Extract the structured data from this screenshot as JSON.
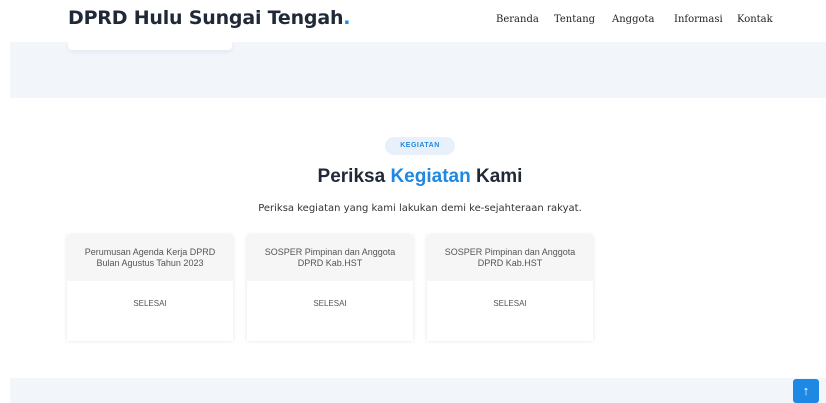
{
  "header": {
    "logo_text": "DPRD Hulu Sungai Tengah",
    "logo_dot": ".",
    "nav": [
      "Beranda",
      "Tentang",
      "Anggota",
      "Informasi",
      "Kontak"
    ]
  },
  "section": {
    "badge": "KEGIATAN",
    "title_before": "Periksa ",
    "title_accent": "Kegiatan",
    "title_after": " Kami",
    "subtitle": "Periksa kegiatan yang kami lakukan demi ke-sejahteraan rakyat."
  },
  "cards": [
    {
      "title": "Perumusan Agenda Kerja DPRD Bulan Agustus Tahun 2023",
      "status": "SELESAI"
    },
    {
      "title": "SOSPER Pimpinan dan Anggota DPRD Kab.HST",
      "status": "SELESAI"
    },
    {
      "title": "SOSPER Pimpinan dan Anggota DPRD Kab.HST",
      "status": "SELESAI"
    }
  ],
  "back_to_top": {
    "icon": "arrow-up-icon",
    "glyph": "↑"
  },
  "colors": {
    "accent": "#1e88e5",
    "band": "#f2f6fb",
    "text_dark": "#1f2937"
  }
}
